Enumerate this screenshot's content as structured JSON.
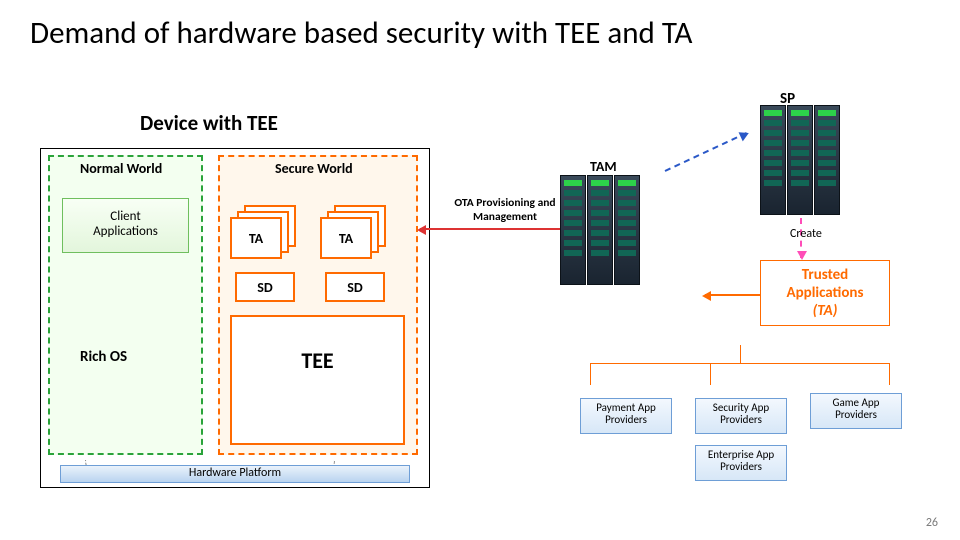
{
  "title": "Demand of hardware based security with TEE and TA",
  "device_label": "Device with TEE",
  "sp": "SP",
  "normal_world": "Normal World",
  "secure_world": "Secure World",
  "client_apps": "Client\nApplications",
  "ta": "TA",
  "sd": "SD",
  "tee": "TEE",
  "rich_os": "Rich OS",
  "hw_platform": "Hardware Platform",
  "tam": "TAM",
  "ota": "OTA Provisioning and Management",
  "create": "Create",
  "trusted_apps_l1": "Trusted",
  "trusted_apps_l2": "Applications",
  "trusted_apps_l3": "(TA)",
  "providers": {
    "payment": "Payment App Providers",
    "security": "Security App Providers",
    "game": "Game App Providers",
    "enterprise": "Enterprise App Providers"
  },
  "page": "26"
}
